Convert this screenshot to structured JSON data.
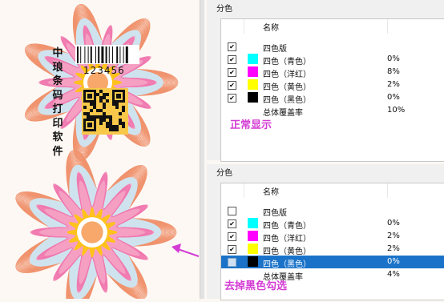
{
  "art": {
    "vertical_text": [
      "中",
      "琅",
      "条",
      "码",
      "打",
      "印",
      "软",
      "件"
    ],
    "barcode_number": "123456"
  },
  "colors": {
    "cyan": "#00ffff",
    "magenta": "#ff00ff",
    "yellow": "#ffff00",
    "black": "#000000",
    "caption": "#d43cd4",
    "selection": "#1a73c9"
  },
  "panels": [
    {
      "title": "分色",
      "header": "名称",
      "caption": "正常显示",
      "rows": [
        {
          "checked": true,
          "swatch": null,
          "name": "四色版",
          "pct": ""
        },
        {
          "checked": true,
          "swatch": "cyan",
          "name": "四色（青色）",
          "pct": "0%"
        },
        {
          "checked": true,
          "swatch": "magenta",
          "name": "四色（洋红）",
          "pct": "8%"
        },
        {
          "checked": true,
          "swatch": "yellow",
          "name": "四色（黄色）",
          "pct": "2%"
        },
        {
          "checked": true,
          "swatch": "black",
          "name": "四色（黑色）",
          "pct": "0%"
        },
        {
          "checked": null,
          "swatch": null,
          "name": "总体覆盖率",
          "pct": "10%"
        }
      ]
    },
    {
      "title": "分色",
      "header": "名称",
      "caption": "去掉黑色勾选",
      "rows": [
        {
          "checked": false,
          "swatch": null,
          "name": "四色版",
          "pct": ""
        },
        {
          "checked": true,
          "swatch": "cyan",
          "name": "四色（青色）",
          "pct": "0%"
        },
        {
          "checked": true,
          "swatch": "magenta",
          "name": "四色（洋红）",
          "pct": "2%"
        },
        {
          "checked": true,
          "swatch": "yellow",
          "name": "四色（黄色）",
          "pct": "2%"
        },
        {
          "checked": false,
          "swatch": "black",
          "name": "四色（黑色）",
          "pct": "0%",
          "selected": true
        },
        {
          "checked": null,
          "swatch": null,
          "name": "总体覆盖率",
          "pct": "4%"
        }
      ]
    }
  ]
}
